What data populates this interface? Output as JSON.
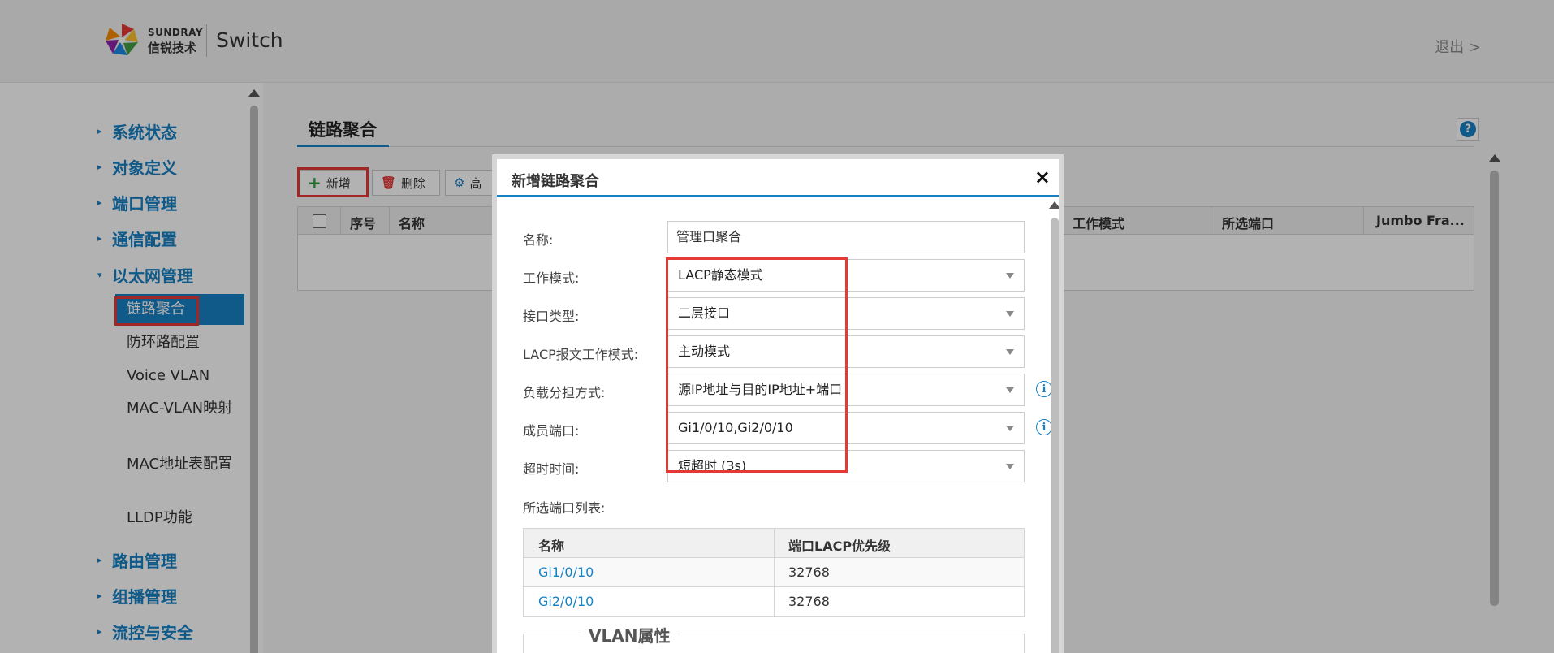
{
  "header": {
    "brand_en": "SUNDRAY",
    "brand_cn": "信锐技术",
    "product": "Switch",
    "logout": "退出 >"
  },
  "sidebar": {
    "groups": [
      {
        "label": "系统状态",
        "expanded": false
      },
      {
        "label": "对象定义",
        "expanded": false
      },
      {
        "label": "端口管理",
        "expanded": false
      },
      {
        "label": "通信配置",
        "expanded": false
      },
      {
        "label": "以太网管理",
        "expanded": true
      },
      {
        "label": "路由管理",
        "expanded": false
      },
      {
        "label": "组播管理",
        "expanded": false
      },
      {
        "label": "流控与安全",
        "expanded": false
      }
    ],
    "subitems": [
      {
        "label": "链路聚合",
        "active": true
      },
      {
        "label": "防环路配置"
      },
      {
        "label": "Voice VLAN"
      },
      {
        "label": "MAC-VLAN映射"
      },
      {
        "label": "MAC地址表配置"
      },
      {
        "label": "LLDP功能"
      }
    ],
    "arrow_collapsed": "▸",
    "arrow_expanded": "▾"
  },
  "page": {
    "title": "链路聚合",
    "help": "?",
    "toolbar": {
      "add": "新增",
      "delete": "删除",
      "advanced": "高"
    },
    "grid_columns": [
      "序号",
      "名称",
      "工作模式",
      "所选端口",
      "Jumbo Fra..."
    ]
  },
  "dialog": {
    "title": "新增链路聚合",
    "close": "×",
    "fields": {
      "name_label": "名称:",
      "name_value": "管理口聚合",
      "mode_label": "工作模式:",
      "mode_value": "LACP静态模式",
      "iface_label": "接口类型:",
      "iface_value": "二层接口",
      "lacp_label": "LACP报文工作模式:",
      "lacp_value": "主动模式",
      "balance_label": "负载分担方式:",
      "balance_value": "源IP地址与目的IP地址+端口",
      "members_label": "成员端口:",
      "members_value": "Gi1/0/10,Gi2/0/10",
      "timeout_label": "超时时间:",
      "timeout_value": "短超时 (3s)",
      "list_label": "所选端口列表:"
    },
    "info_icon": "i",
    "port_table": {
      "headers": [
        "名称",
        "端口LACP优先级"
      ],
      "rows": [
        {
          "name": "Gi1/0/10",
          "priority": "32768"
        },
        {
          "name": "Gi2/0/10",
          "priority": "32768"
        }
      ]
    },
    "vlan_section": "VLAN属性"
  }
}
